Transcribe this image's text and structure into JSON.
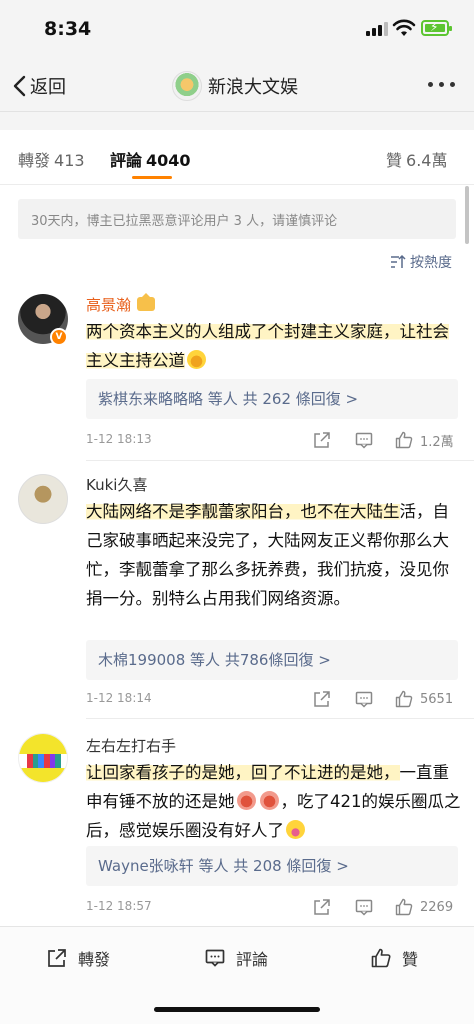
{
  "status_bar": {
    "time": "8:34"
  },
  "nav": {
    "back_label": "返回",
    "title": "新浪大文娱"
  },
  "tabs": [
    {
      "label": "轉發",
      "count": "413"
    },
    {
      "label": "評論",
      "count": "4040"
    },
    {
      "label": "贊",
      "count": "6.4萬"
    }
  ],
  "notice": "30天内，博主已拉黑恶意评论用户 3 人，请谨慎评论",
  "sort_label": "按熱度",
  "comments": [
    {
      "username": "高景瀚",
      "text_highlight": "两个资本主义的人组成了个封建主义家庭，让社会主义主持公道",
      "text_rest": "",
      "replies_user": "紫棋东来略略略",
      "replies_mid": "等人",
      "replies_total": "共 262 條回復 >",
      "date": "1-12 18:13",
      "likes": "1.2萬"
    },
    {
      "username": "Kuki久喜",
      "text_highlight": "大陆网络不是李靓蕾家阳台，也不在大陆生",
      "text_rest": "活，自己家破事晒起来没完了，大陆网友正义帮你那么大忙，李靓蕾拿了那么多抚养费，我们抗疫，没见你捐一分。别特么占用我们网络资源。",
      "replies_user": "木棉199008",
      "replies_mid": "等人",
      "replies_total": "共786條回復 >",
      "date": "1-12 18:14",
      "likes": "5651"
    },
    {
      "username": "左右左打右手",
      "text_highlight": "让回家看孩子的是她，回了不让进的是她，",
      "text_rest": "一直重申有锤不放的还是她",
      "text_rest2": "，吃了421的娱乐圈瓜之后，感觉娱乐圈没有好人了",
      "replies_user": "Wayne张咏轩",
      "replies_mid": "等人",
      "replies_total": "共 208 條回復 >",
      "date": "1-12 18:57",
      "likes": "2269"
    }
  ],
  "bottom_bar": {
    "repost": "轉發",
    "comment": "評論",
    "like": "贊"
  },
  "colors": {
    "accent": "#ff8200",
    "link": "#5a6b8c",
    "vip_name": "#e8601c",
    "highlight": "#fff4c4"
  }
}
